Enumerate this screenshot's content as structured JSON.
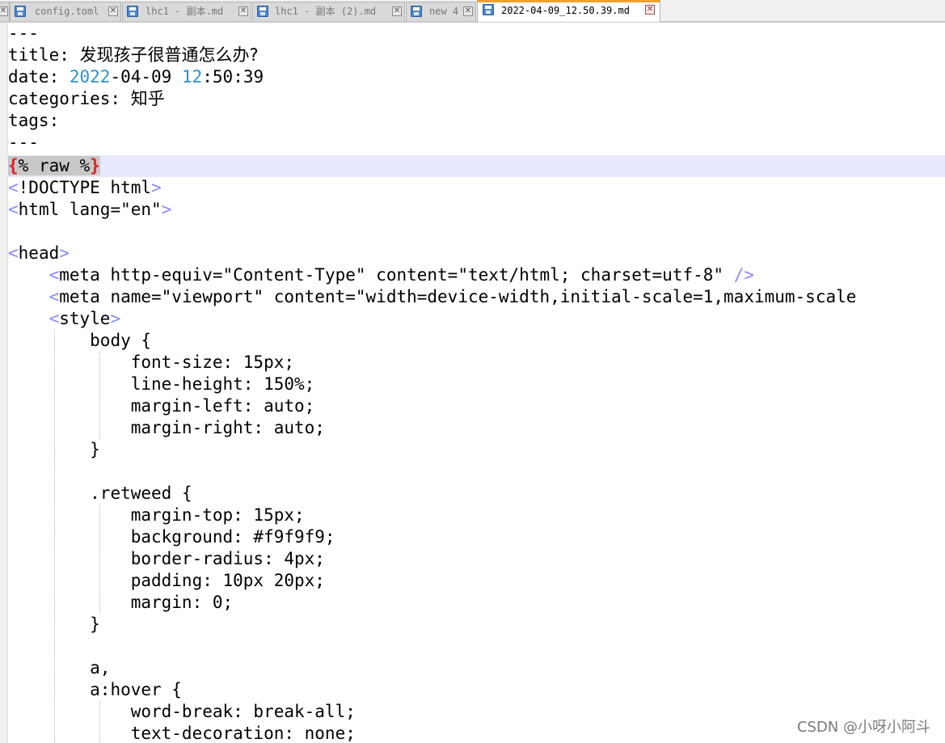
{
  "tabs": [
    {
      "label": "config.toml",
      "active": false
    },
    {
      "label": "lhc1 - 副本.md",
      "active": false
    },
    {
      "label": "lhc1 - 副本 (2).md",
      "active": false
    },
    {
      "label": "new 4",
      "active": false
    },
    {
      "label": "2022-04-09_12.50.39.md",
      "active": true
    }
  ],
  "editor": {
    "front_matter": {
      "sep_open": "---",
      "title_key": "title:",
      "title_value": "发现孩子很普通怎么办?",
      "date_key": "date:",
      "date_year": "2022",
      "date_rest": "-04-09",
      "date_hour": "12",
      "date_time_rest": ":50:39",
      "categories_key": "categories:",
      "categories_value": "知乎",
      "tags_key": "tags:",
      "sep_close": "---"
    },
    "raw": {
      "open": "{",
      "body": "% raw %",
      "close": "}"
    },
    "doctype": {
      "lt": "<",
      "text": "!DOCTYPE html",
      "gt": ">"
    },
    "html_open": {
      "lt": "<",
      "text": "html lang=\"en\"",
      "gt": ">"
    },
    "head_open": {
      "lt": "<",
      "text": "head",
      "gt": ">"
    },
    "meta1": {
      "lt": "<",
      "text": "meta http-equiv=\"Content-Type\" content=\"text/html; charset=utf-8\" ",
      "gt": "/>"
    },
    "meta2": {
      "lt": "<",
      "text": "meta name=\"viewport\" content=\"width=device-width,initial-scale=1,maximum-scale"
    },
    "style_open": {
      "lt": "<",
      "text": "style",
      "gt": ">"
    },
    "css": [
      "body {",
      "font-size: 15px;",
      "line-height: 150%;",
      "margin-left: auto;",
      "margin-right: auto;",
      "}",
      ".retweed {",
      "margin-top: 15px;",
      "background: #f9f9f9;",
      "border-radius: 4px;",
      "padding: 10px 20px;",
      "margin: 0;",
      "}",
      "a,",
      "a:hover {",
      "word-break: break-all;",
      "text-decoration: none;"
    ]
  },
  "watermark": "CSDN @小呀小阿斗",
  "colors": {
    "number": "#2f8fd0",
    "tag_bracket": "#8a8aff",
    "raw_brace": "#e02020",
    "current_line": "#e8e8ff",
    "active_tab_accent": "#f0a030"
  }
}
